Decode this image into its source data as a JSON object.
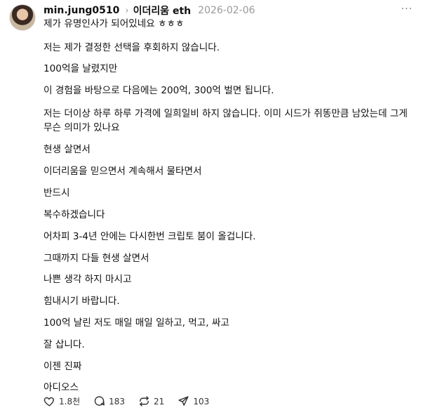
{
  "post": {
    "username": "min.jung0510",
    "community": "이더리움 eth",
    "date": "2026-02-06",
    "more_label": "···",
    "lines": [
      "제가 유명인사가 되어있네요 ㅎㅎㅎ",
      "저는 제가 결정한 선택을 후회하지 않습니다.",
      "100억을 날렸지만",
      "이 경험을 바탕으로 다음에는 200억, 300억 벌면 됩니다.",
      "저는 더이상 하루 하루 가격에 일희일비 하지 않습니다. 이미 시드가 쥐똥만큼 남았는데 그게 무슨 의미가 있나요",
      "현생 살면서",
      "이더리움을 믿으면서 계속해서 물타면서",
      "반드시",
      "복수하겠습니다",
      "어차피 3-4년 안에는 다시한번 크립토 붐이 올겁니다.",
      "그때까지 다들 현생 살면서",
      "나쁜 생각 하지 마시고",
      "힘내시기 바랍니다.",
      "100억 날린 저도 매일 매일 일하고, 먹고, 싸고",
      "잘 삽니다.",
      "이젠 진짜",
      "아디오스"
    ]
  },
  "actions": {
    "likes": "1.8천",
    "comments": "183",
    "reposts": "21",
    "shares": "103"
  },
  "icons": [
    "avatar",
    "chevron-right-icon",
    "more-icon",
    "heart-icon",
    "comment-icon",
    "repost-icon",
    "share-icon"
  ]
}
